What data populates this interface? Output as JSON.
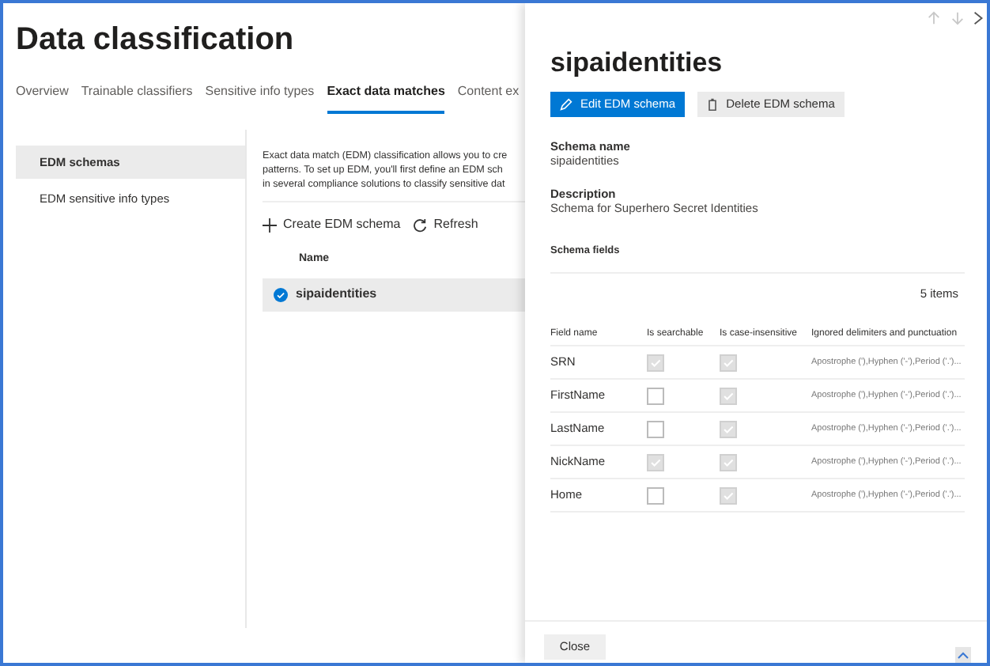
{
  "page": {
    "title": "Data classification",
    "tabs": [
      {
        "label": "Overview",
        "selected": false
      },
      {
        "label": "Trainable classifiers",
        "selected": false
      },
      {
        "label": "Sensitive info types",
        "selected": false
      },
      {
        "label": "Exact data matches",
        "selected": true
      },
      {
        "label": "Content ex",
        "selected": false
      }
    ],
    "nav": [
      {
        "label": "EDM schemas",
        "selected": true
      },
      {
        "label": "EDM sensitive info types",
        "selected": false
      }
    ],
    "description_lines": [
      "Exact data match (EDM) classification allows you to cre",
      "patterns. To set up EDM, you'll first define an EDM sch",
      "in several compliance solutions to classify sensitive dat"
    ],
    "toolbar": [
      "Create EDM schema",
      "Refresh"
    ],
    "list": {
      "header": "Name",
      "rows": [
        {
          "name": "sipaidentities",
          "selected": true
        }
      ]
    }
  },
  "panel": {
    "title": "sipaidentities",
    "buttons": [
      {
        "label": "Edit EDM schema",
        "kind": "primary"
      },
      {
        "label": "Delete EDM schema",
        "kind": "secondary"
      }
    ],
    "details": [
      {
        "label": "Schema name",
        "value": "sipaidentities"
      },
      {
        "label": "Description",
        "value": "Schema for Superhero Secret Identities"
      }
    ],
    "fields_heading": "Schema fields",
    "count": "5 items",
    "table": {
      "columns": [
        "Field name",
        "Is searchable",
        "Is case-insensitive",
        "Ignored delimiters and punctuation"
      ],
      "rows": [
        {
          "name": "SRN",
          "searchable": true,
          "case_insensitive": true,
          "delimiters": "Apostrophe ('),Hyphen ('-'),Period ('.')..."
        },
        {
          "name": "FirstName",
          "searchable": false,
          "case_insensitive": true,
          "delimiters": "Apostrophe ('),Hyphen ('-'),Period ('.')..."
        },
        {
          "name": "LastName",
          "searchable": false,
          "case_insensitive": true,
          "delimiters": "Apostrophe ('),Hyphen ('-'),Period ('.')..."
        },
        {
          "name": "NickName",
          "searchable": true,
          "case_insensitive": true,
          "delimiters": "Apostrophe ('),Hyphen ('-'),Period ('.')..."
        },
        {
          "name": "Home",
          "searchable": false,
          "case_insensitive": true,
          "delimiters": "Apostrophe ('),Hyphen ('-'),Period ('.')..."
        }
      ]
    },
    "close": "Close"
  }
}
